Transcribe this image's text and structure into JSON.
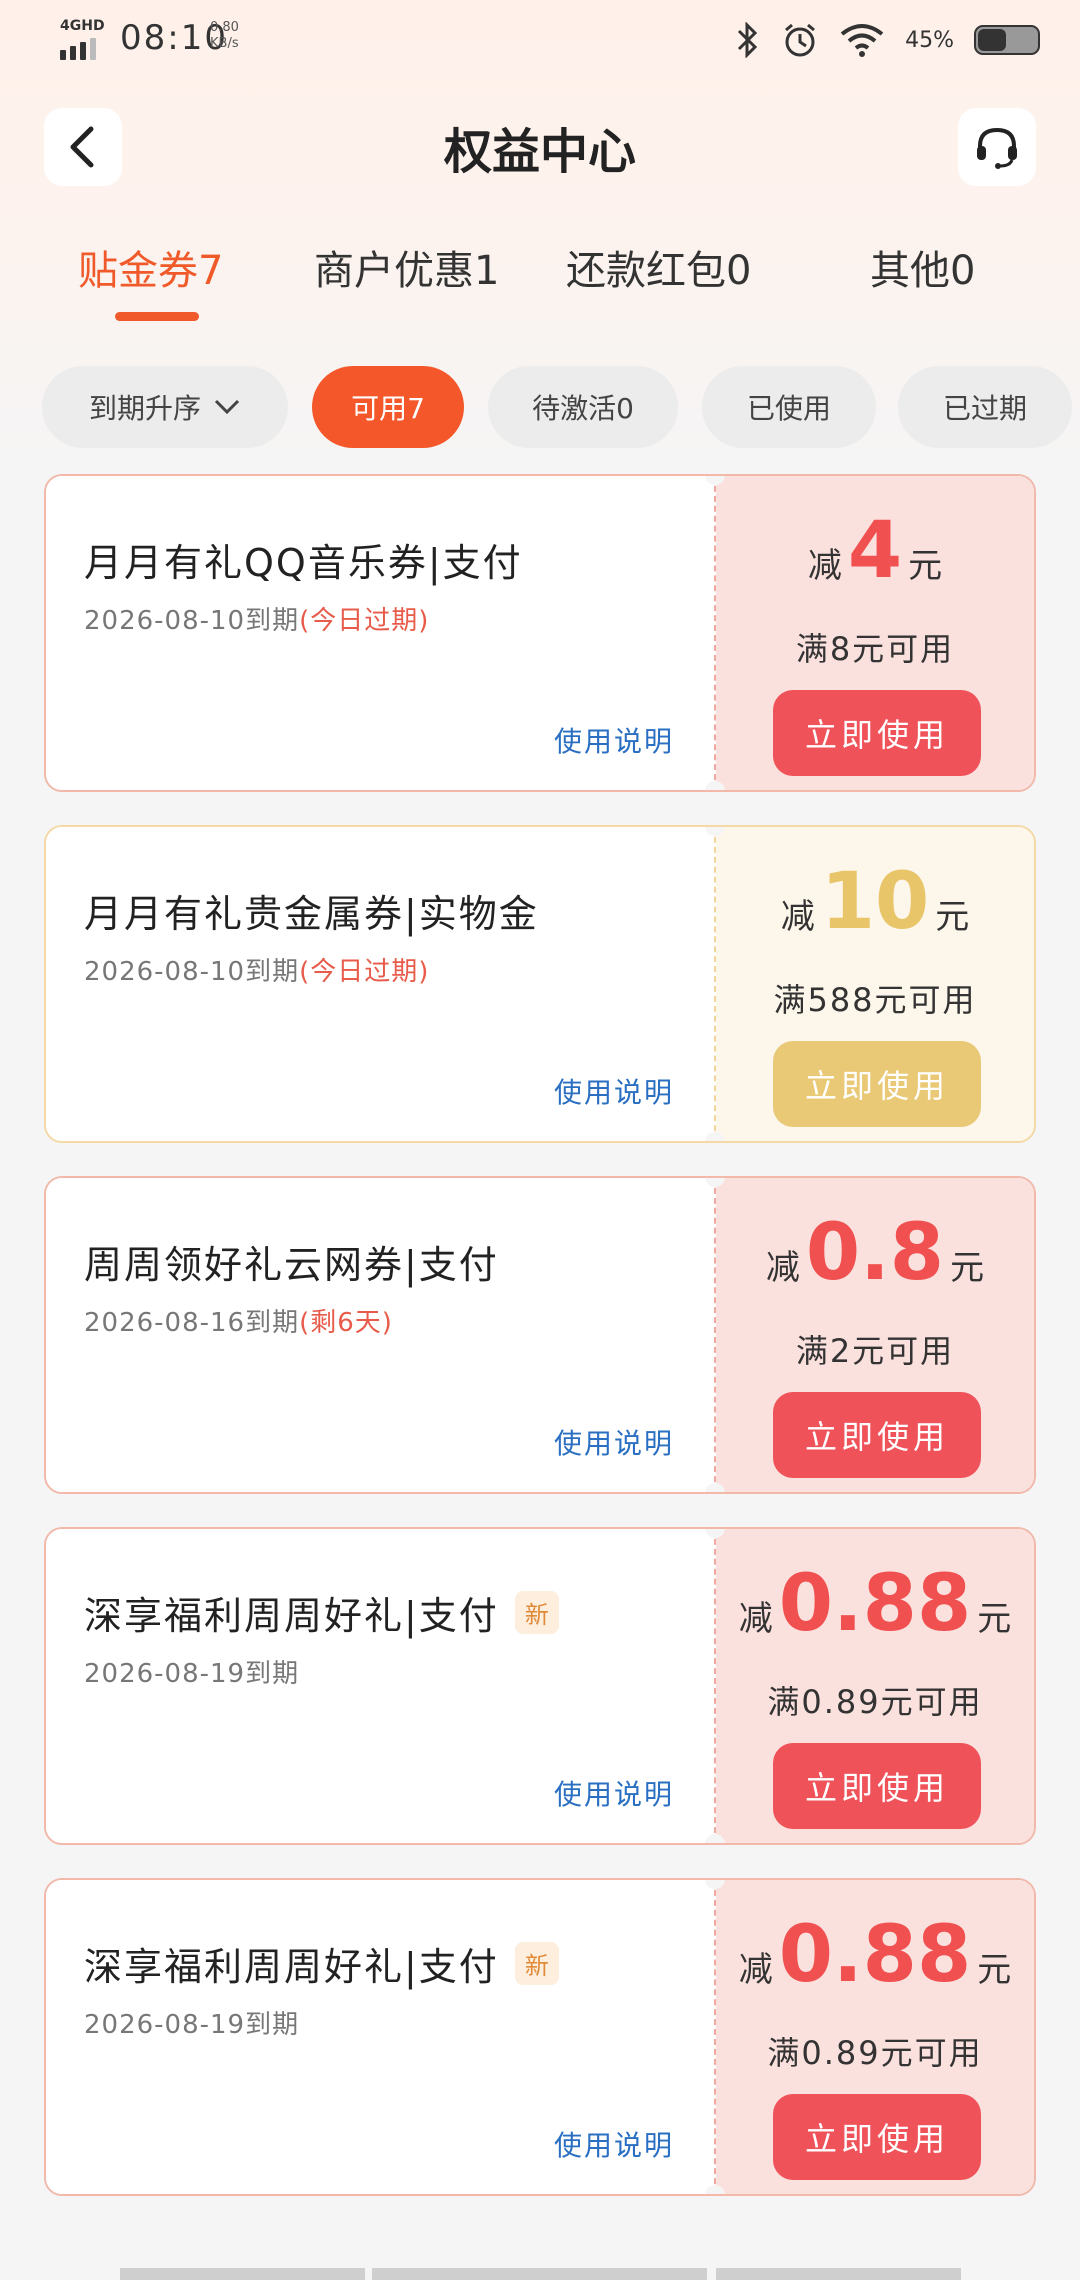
{
  "status_bar": {
    "network": "4GHD",
    "time": "08:10",
    "speed_value": "0.80",
    "speed_unit": "KB/s",
    "battery_percent": "45%",
    "battery_level": 0.45
  },
  "header": {
    "title": "权益中心",
    "back_icon": "back-arrow-icon",
    "service_icon": "headset-icon"
  },
  "tabs": [
    {
      "label": "贴金券7",
      "active": true
    },
    {
      "label": "商户优惠1",
      "active": false
    },
    {
      "label": "还款红包0",
      "active": false
    },
    {
      "label": "其他0",
      "active": false
    }
  ],
  "filters": {
    "sort_label": "到期升序",
    "chips": [
      {
        "label": "可用7",
        "active": true
      },
      {
        "label": "待激活0",
        "active": false
      },
      {
        "label": "已使用",
        "active": false
      },
      {
        "label": "已过期",
        "active": false
      }
    ]
  },
  "coupons": [
    {
      "title": "月月有礼QQ音乐券|支付",
      "date": "2026-08-10到期",
      "note": "(今日过期)",
      "badge": "",
      "prefix": "减",
      "amount": "4",
      "suffix": "元",
      "condition": "满8元可用",
      "button": "立即使用",
      "help": "使用说明",
      "style": "red"
    },
    {
      "title": "月月有礼贵金属券|实物金",
      "date": "2026-08-10到期",
      "note": "(今日过期)",
      "badge": "",
      "prefix": "减",
      "amount": "10",
      "suffix": "元",
      "condition": "满588元可用",
      "button": "立即使用",
      "help": "使用说明",
      "style": "gold"
    },
    {
      "title": "周周领好礼云网券|支付",
      "date": "2026-08-16到期",
      "note": "(剩6天)",
      "badge": "",
      "prefix": "减",
      "amount": "0.8",
      "suffix": "元",
      "condition": "满2元可用",
      "button": "立即使用",
      "help": "使用说明",
      "style": "red"
    },
    {
      "title": "深享福利周周好礼|支付",
      "date": "2026-08-19到期",
      "note": "",
      "badge": "新",
      "prefix": "减",
      "amount": "0.88",
      "suffix": "元",
      "condition": "满0.89元可用",
      "button": "立即使用",
      "help": "使用说明",
      "style": "red"
    },
    {
      "title": "深享福利周周好礼|支付",
      "date": "2026-08-19到期",
      "note": "",
      "badge": "新",
      "prefix": "减",
      "amount": "0.88",
      "suffix": "元",
      "condition": "满0.89元可用",
      "button": "立即使用",
      "help": "使用说明",
      "style": "red"
    }
  ],
  "colors": {
    "accent": "#f05a2a",
    "coupon_red": "#f0525a",
    "coupon_gold": "#e9c876",
    "link_blue": "#2a6fc2"
  }
}
